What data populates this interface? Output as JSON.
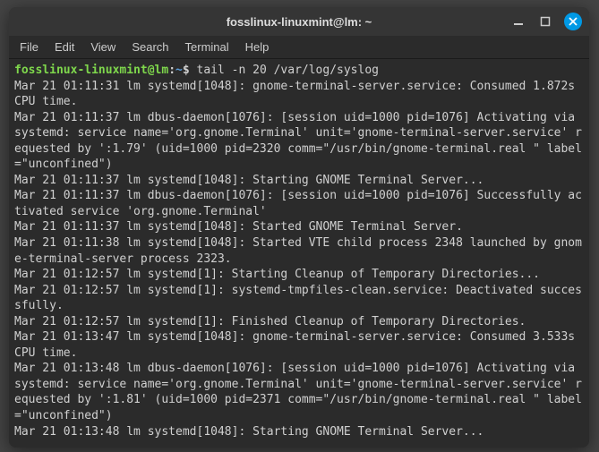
{
  "title": "fosslinux-linuxmint@lm: ~",
  "menu": [
    "File",
    "Edit",
    "View",
    "Search",
    "Terminal",
    "Help"
  ],
  "prompt": {
    "user": "fosslinux-linuxmint@lm",
    "sep1": ":",
    "path": "~",
    "sep2": "$ "
  },
  "cmd": "tail -n 20 /var/log/syslog",
  "lines": [
    "Mar 21 01:11:31 lm systemd[1048]: gnome-terminal-server.service: Consumed 1.872s CPU time.",
    "Mar 21 01:11:37 lm dbus-daemon[1076]: [session uid=1000 pid=1076] Activating via systemd: service name='org.gnome.Terminal' unit='gnome-terminal-server.service' requested by ':1.79' (uid=1000 pid=2320 comm=\"/usr/bin/gnome-terminal.real \" label=\"unconfined\")",
    "Mar 21 01:11:37 lm systemd[1048]: Starting GNOME Terminal Server...",
    "Mar 21 01:11:37 lm dbus-daemon[1076]: [session uid=1000 pid=1076] Successfully activated service 'org.gnome.Terminal'",
    "Mar 21 01:11:37 lm systemd[1048]: Started GNOME Terminal Server.",
    "Mar 21 01:11:38 lm systemd[1048]: Started VTE child process 2348 launched by gnome-terminal-server process 2323.",
    "Mar 21 01:12:57 lm systemd[1]: Starting Cleanup of Temporary Directories...",
    "Mar 21 01:12:57 lm systemd[1]: systemd-tmpfiles-clean.service: Deactivated successfully.",
    "Mar 21 01:12:57 lm systemd[1]: Finished Cleanup of Temporary Directories.",
    "Mar 21 01:13:47 lm systemd[1048]: gnome-terminal-server.service: Consumed 3.533s CPU time.",
    "Mar 21 01:13:48 lm dbus-daemon[1076]: [session uid=1000 pid=1076] Activating via systemd: service name='org.gnome.Terminal' unit='gnome-terminal-server.service' requested by ':1.81' (uid=1000 pid=2371 comm=\"/usr/bin/gnome-terminal.real \" label=\"unconfined\")",
    "Mar 21 01:13:48 lm systemd[1048]: Starting GNOME Terminal Server..."
  ]
}
